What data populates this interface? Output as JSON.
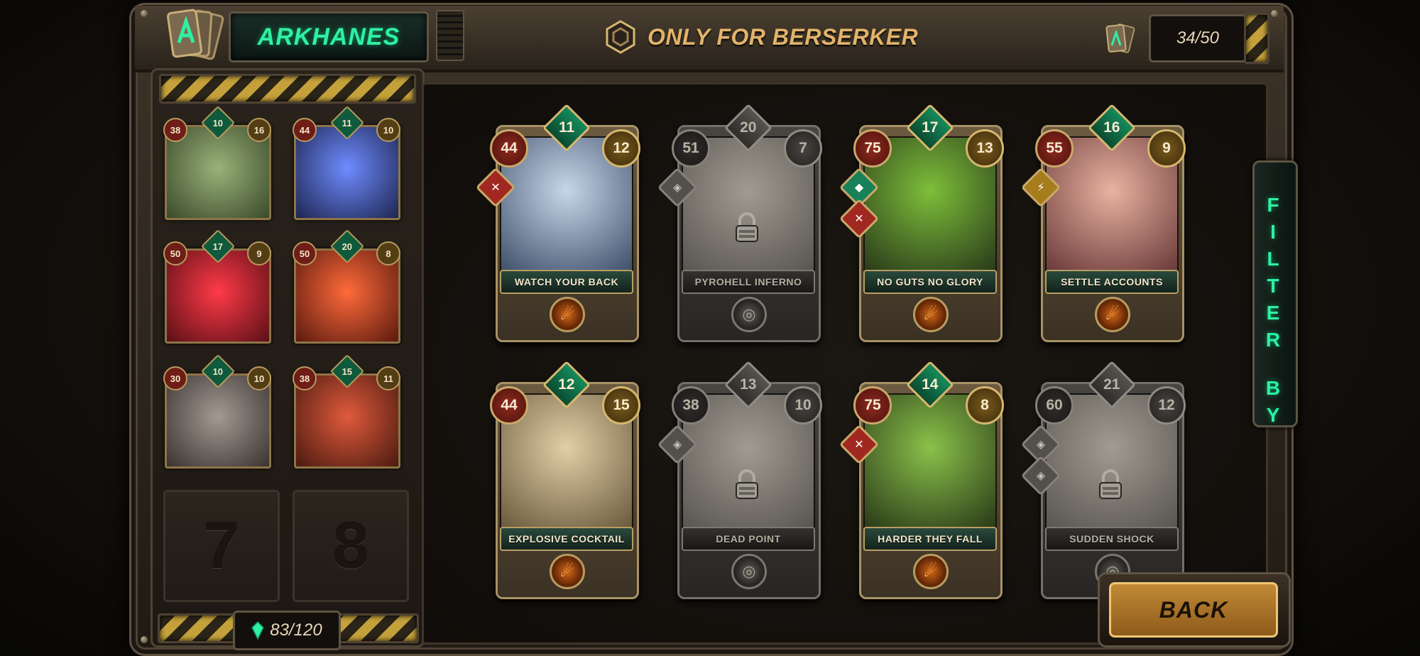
{
  "deck": {
    "name": "ARKHANES",
    "card_count": "34/50",
    "crystals": "83/120"
  },
  "header": {
    "filter_label": "ONLY FOR BERSERKER"
  },
  "side_tab": {
    "label_line1": "FILTER",
    "label_line2": "BY"
  },
  "back_label": "BACK",
  "deck_slots": [
    {
      "red": "38",
      "green": "10",
      "gold": "16",
      "art": [
        "#9bb27a",
        "#3a4a2a"
      ]
    },
    {
      "red": "44",
      "green": "11",
      "gold": "10",
      "art": [
        "#6f8cff",
        "#1d2550"
      ]
    },
    {
      "red": "50",
      "green": "17",
      "gold": "9",
      "art": [
        "#ff3a48",
        "#5a0f16"
      ]
    },
    {
      "red": "50",
      "green": "20",
      "gold": "8",
      "art": [
        "#ff6a3a",
        "#5a1a0f"
      ]
    },
    {
      "red": "30",
      "green": "10",
      "gold": "10",
      "art": [
        "#a39a92",
        "#3a3330"
      ]
    },
    {
      "red": "38",
      "green": "15",
      "gold": "11",
      "art": [
        "#e05a3c",
        "#4a1a10"
      ]
    }
  ],
  "empty_slots": [
    "7",
    "8"
  ],
  "cards": [
    {
      "title": "WATCH YOUR BACK",
      "red": "44",
      "green": "11",
      "gold": "12",
      "locked": false,
      "tags": [
        "red"
      ],
      "art": [
        "#c7d7ea",
        "#40506a"
      ]
    },
    {
      "title": "PYROHELL INFERNO",
      "red": "51",
      "green": "20",
      "gold": "7",
      "locked": true,
      "tags": [
        "grey"
      ],
      "art": [
        "#d8cdb3",
        "#7a7060"
      ]
    },
    {
      "title": "NO GUTS NO GLORY",
      "red": "75",
      "green": "17",
      "gold": "13",
      "locked": false,
      "tags": [
        "green",
        "red"
      ],
      "art": [
        "#7dbf3a",
        "#2a3a1a"
      ]
    },
    {
      "title": "SETTLE ACCOUNTS",
      "red": "55",
      "green": "16",
      "gold": "9",
      "locked": false,
      "tags": [
        "gold"
      ],
      "art": [
        "#e9b2a0",
        "#6a3a3a"
      ]
    },
    {
      "title": "EXPLOSIVE COCKTAIL",
      "red": "44",
      "green": "12",
      "gold": "15",
      "locked": false,
      "tags": [],
      "art": [
        "#e2cfa8",
        "#6a5a3c"
      ]
    },
    {
      "title": "DEAD POINT",
      "red": "38",
      "green": "13",
      "gold": "10",
      "locked": true,
      "tags": [
        "grey"
      ],
      "art": [
        "#d8cdb3",
        "#7a7060"
      ]
    },
    {
      "title": "HARDER THEY FALL",
      "red": "75",
      "green": "14",
      "gold": "8",
      "locked": false,
      "tags": [
        "red"
      ],
      "art": [
        "#8ac14a",
        "#2a3a18"
      ]
    },
    {
      "title": "SUDDEN SHOCK",
      "red": "60",
      "green": "21",
      "gold": "12",
      "locked": true,
      "tags": [
        "grey",
        "grey"
      ],
      "art": [
        "#d8cdb3",
        "#7a7060"
      ]
    }
  ]
}
